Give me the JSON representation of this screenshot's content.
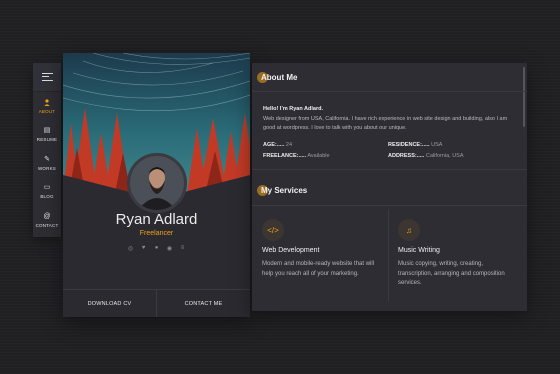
{
  "nav": {
    "items": [
      {
        "icon": "person-icon",
        "glyph": "👤",
        "label": "ABOUT"
      },
      {
        "icon": "resume-icon",
        "glyph": "▤",
        "label": "RESUME"
      },
      {
        "icon": "pencil-icon",
        "glyph": "✎",
        "label": "WORKS"
      },
      {
        "icon": "chat-icon",
        "glyph": "▭",
        "label": "BLOG"
      },
      {
        "icon": "at-icon",
        "glyph": "@",
        "label": "CONTACT"
      }
    ],
    "active": "ABOUT"
  },
  "profile": {
    "name": "Ryan Adlard",
    "role": "Freelancer",
    "socials": [
      "dribbble-icon",
      "twitter-icon",
      "github-icon",
      "spotify-icon",
      "stackoverflow-icon"
    ],
    "download_cv": "DOWNLOAD CV",
    "contact_me": "CONTACT ME"
  },
  "about": {
    "title": "About Me",
    "hello": "Hello! I’m Ryan Adlard.",
    "bio": "Web designer from USA, California. I have rich experience in web site design and building, also I am good at wordpress. I love to talk with you about our unique.",
    "fields": [
      {
        "key": "AGE:.....",
        "value": "24"
      },
      {
        "key": "RESIDENCE:.....",
        "value": "USA"
      },
      {
        "key": "FREELANCE:.....",
        "value": "Available"
      },
      {
        "key": "ADDRESS:.....",
        "value": "California, USA"
      }
    ]
  },
  "services": {
    "title": "My Services",
    "items": [
      {
        "icon": "code-icon",
        "glyph": "</>",
        "title": "Web Development",
        "desc": "Modern and mobile-ready website that will help you reach all of your marketing."
      },
      {
        "icon": "music-icon",
        "glyph": "♫",
        "title": "Music Writing",
        "desc": "Music copying, writing, creating, transcription, arranging and composition services."
      }
    ]
  },
  "colors": {
    "accent": "#f0a318",
    "panel": "#2e2d33",
    "background": "#202023"
  }
}
